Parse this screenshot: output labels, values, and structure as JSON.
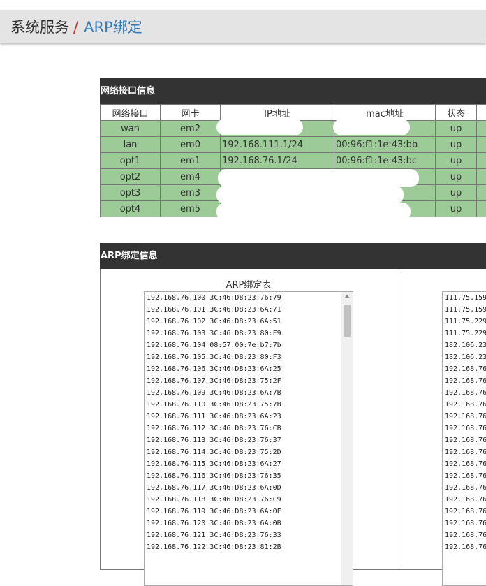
{
  "breadcrumb": {
    "parent": "系统服务",
    "separator": "/",
    "current": "ARP绑定"
  },
  "interfaces": {
    "title": "网络接口信息",
    "headers": [
      "网络接口",
      "网卡",
      "IP地址",
      "mac地址",
      "状态"
    ],
    "rows": [
      {
        "iface": "wan",
        "nic": "em2",
        "ip": "",
        "mac": "",
        "status": "up"
      },
      {
        "iface": "lan",
        "nic": "em0",
        "ip": "192.168.111.1/24",
        "mac": "00:96:f1:1e:43:bb",
        "status": "up"
      },
      {
        "iface": "opt1",
        "nic": "em1",
        "ip": "192.168.76.1/24",
        "mac": "00:96:f1:1e:43:bc",
        "status": "up"
      },
      {
        "iface": "opt2",
        "nic": "em4",
        "ip": "",
        "mac": "",
        "status": "up"
      },
      {
        "iface": "opt3",
        "nic": "em3",
        "ip": "",
        "mac": "",
        "status": "up"
      },
      {
        "iface": "opt4",
        "nic": "em5",
        "ip": "",
        "mac": "",
        "status": "up"
      }
    ]
  },
  "arp": {
    "title": "ARP绑定信息",
    "table_label": "ARP绑定表",
    "entries": [
      "192.168.76.100 3C:46:D8:23:76:79",
      "192.168.76.101 3C:46:D8:23:6A:71",
      "192.168.76.102 3C:46:D8:23:6A:51",
      "192.168.76.103 3C:46:D8:23:80:F9",
      "192.168.76.104 08:57:00:7e:b7:7b",
      "192.168.76.105 3C:46:D8:23:80:F3",
      "192.168.76.106 3C:46:D8:23:6A:25",
      "192.168.76.107 3C:46:D8:23:75:2F",
      "192.168.76.109 3C:46:D8:23:6A:7B",
      "192.168.76.110 3C:46:D8:23:75:7B",
      "192.168.76.111 3C:46:D8:23:6A:23",
      "192.168.76.112 3C:46:D8:23:76:CB",
      "192.168.76.113 3C:46:D8:23:76:37",
      "192.168.76.114 3C:46:D8:23:75:2D",
      "192.168.76.115 3C:46:D8:23:6A:27",
      "192.168.76.116 3C:46:D8:23:76:35",
      "192.168.76.117 3C:46:D8:23:6A:0D",
      "192.168.76.118 3C:46:D8:23:76:C9",
      "192.168.76.119 3C:46:D8:23:6A:0F",
      "192.168.76.120 3C:46:D8:23:6A:0B",
      "192.168.76.121 3C:46:D8:23:76:33",
      "192.168.76.122 3C:46:D8:23:81:2B"
    ],
    "entries2": [
      "111.75.159",
      "111.75.159",
      "111.75.229",
      "111.75.229",
      "182.106.23",
      "182.106.23",
      "192.168.76",
      "192.168.76",
      "192.168.76",
      "192.168.76",
      "192.168.76",
      "192.168.76",
      "192.168.76",
      "192.168.76",
      "192.168.76",
      "192.168.76",
      "192.168.76",
      "192.168.76",
      "192.168.76",
      "192.168.76",
      "192.168.76",
      "192.168.76"
    ]
  },
  "colors": {
    "row_bg": "#9ccb98",
    "title_bg": "#333333",
    "breadcrumb_link": "#337ab7",
    "separator": "#c0392b"
  }
}
